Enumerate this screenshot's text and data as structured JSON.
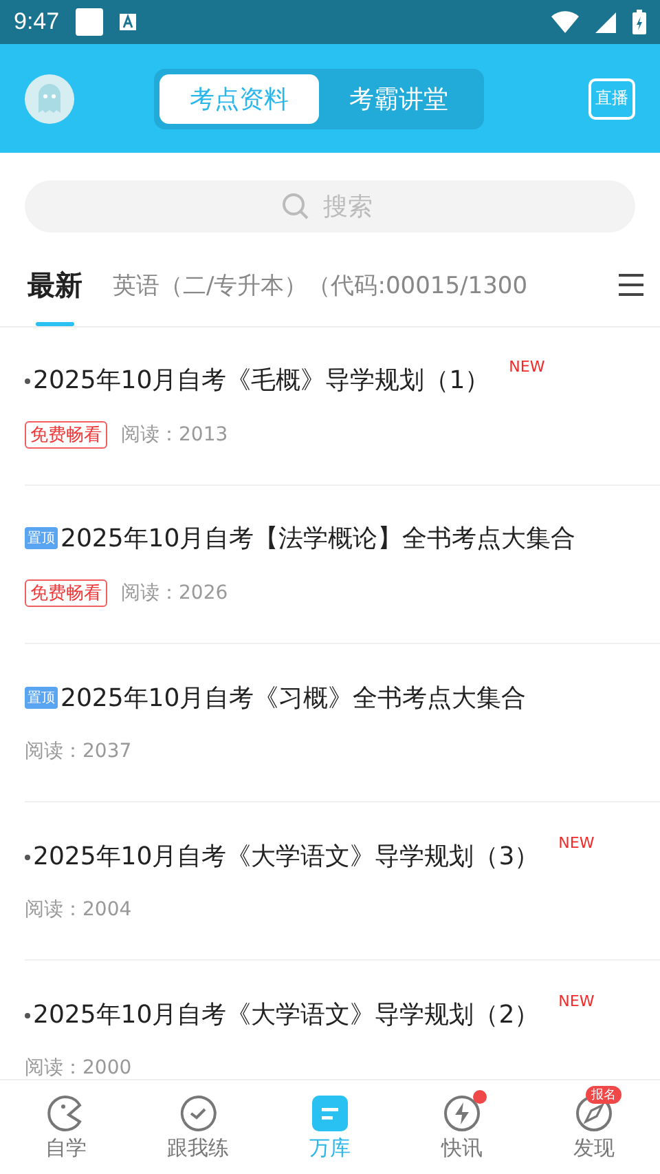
{
  "status_bar": {
    "time": "9:47"
  },
  "header": {
    "tabs": [
      {
        "label": "考点资料",
        "selected": true
      },
      {
        "label": "考霸讲堂",
        "selected": false
      }
    ],
    "live_label": "直播"
  },
  "search": {
    "placeholder": "搜索"
  },
  "categories": [
    {
      "label": "最新",
      "selected": true
    },
    {
      "label": "英语（二/专升本）（代码:00015/1300",
      "selected": false
    }
  ],
  "articles": [
    {
      "kind": "dot",
      "title": "2025年10月自考《毛概》导学规划（1）",
      "new_label": "NEW",
      "tag": "免费畅看",
      "reads": "阅读：2013"
    },
    {
      "kind": "pinned",
      "badge": "置顶",
      "title": "2025年10月自考【法学概论】全书考点大集合",
      "tag": "免费畅看",
      "reads": "阅读：2026"
    },
    {
      "kind": "pinned",
      "badge": "置顶",
      "title": "2025年10月自考《习概》全书考点大集合",
      "reads": "阅读：2037"
    },
    {
      "kind": "dot",
      "title": "2025年10月自考《大学语文》导学规划（3）",
      "new_label": "NEW",
      "reads": "阅读：2004"
    },
    {
      "kind": "dot",
      "title": "2025年10月自考《大学语文》导学规划（2）",
      "new_label": "NEW",
      "reads": "阅读：2000"
    }
  ],
  "bottom_nav": [
    {
      "kind": "study",
      "label": "自学",
      "selected": false
    },
    {
      "kind": "practice",
      "label": "跟我练",
      "selected": false
    },
    {
      "kind": "library",
      "label": "万库",
      "selected": true
    },
    {
      "kind": "news",
      "label": "快讯",
      "selected": false,
      "dot": true
    },
    {
      "kind": "discover",
      "label": "发现",
      "selected": false,
      "badge": "报名"
    }
  ]
}
